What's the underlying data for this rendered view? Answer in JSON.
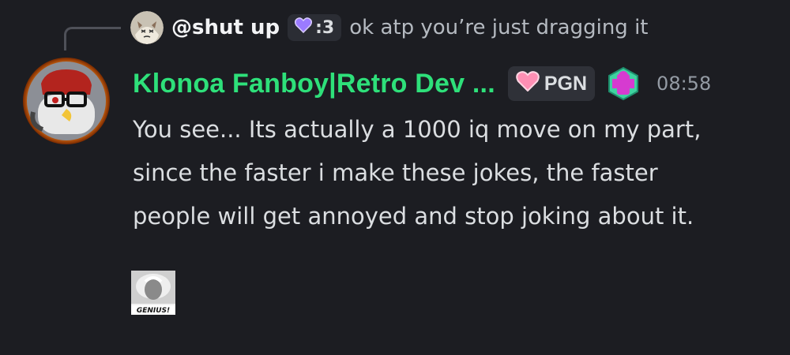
{
  "reply": {
    "username": "@shut up",
    "tag_label": ":3",
    "preview_text": "ok atp you’re just dragging it"
  },
  "message": {
    "author": "Klonoa Fanboy|Retro Dev ...",
    "author_color": "#2ee07a",
    "guild_tag": "PGN",
    "role_icon": "hexagon-role-icon",
    "timestamp": "08:58",
    "lines": [
      "You see... Its actually a 1000 iq move on my part,",
      "since the faster i make these jokes, the faster",
      "people will get annoyed and stop joking about it."
    ]
  },
  "sticker": {
    "caption": "GENIUS!"
  }
}
